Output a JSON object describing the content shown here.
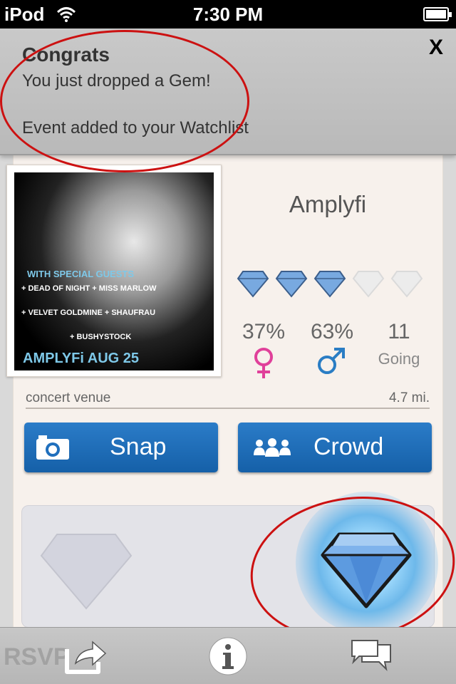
{
  "status_bar": {
    "device": "iPod",
    "time": "7:30 PM",
    "icons": [
      "wifi-icon",
      "battery-icon"
    ]
  },
  "banner": {
    "title": "Congrats",
    "message": "You just dropped a Gem!",
    "sub_message": "Event added to your Watchlist",
    "close_label": "X",
    "annotation_color": "#cc1111"
  },
  "poster": {
    "line1": "WITH SPECIAL GUESTS",
    "line2": "+ DEAD OF NIGHT + MISS MARLOW",
    "line3": "+ VELVET GOLDMINE + SHAUFRAU",
    "line4": "+ BUSHYSTOCK",
    "line5": "AMPLYFi  AUG 25"
  },
  "event": {
    "name": "Amplyfi",
    "gem_rating": 3,
    "gem_max": 5,
    "female_pct": "37%",
    "male_pct": "63%",
    "going_count": "11",
    "going_label": "Going",
    "venue": "concert venue",
    "distance": "4.7 mi."
  },
  "actions": {
    "snap_label": "Snap",
    "crowd_label": "Crowd"
  },
  "toolbar": {
    "rsvp_label": "RSVP",
    "icons": [
      "share-icon",
      "info-icon",
      "chat-icon"
    ]
  },
  "colors": {
    "accent_blue": "#1f6fbd",
    "female_pink": "#e0409a",
    "male_blue": "#2a7dc4",
    "gem_blue": "#78a9e0"
  }
}
